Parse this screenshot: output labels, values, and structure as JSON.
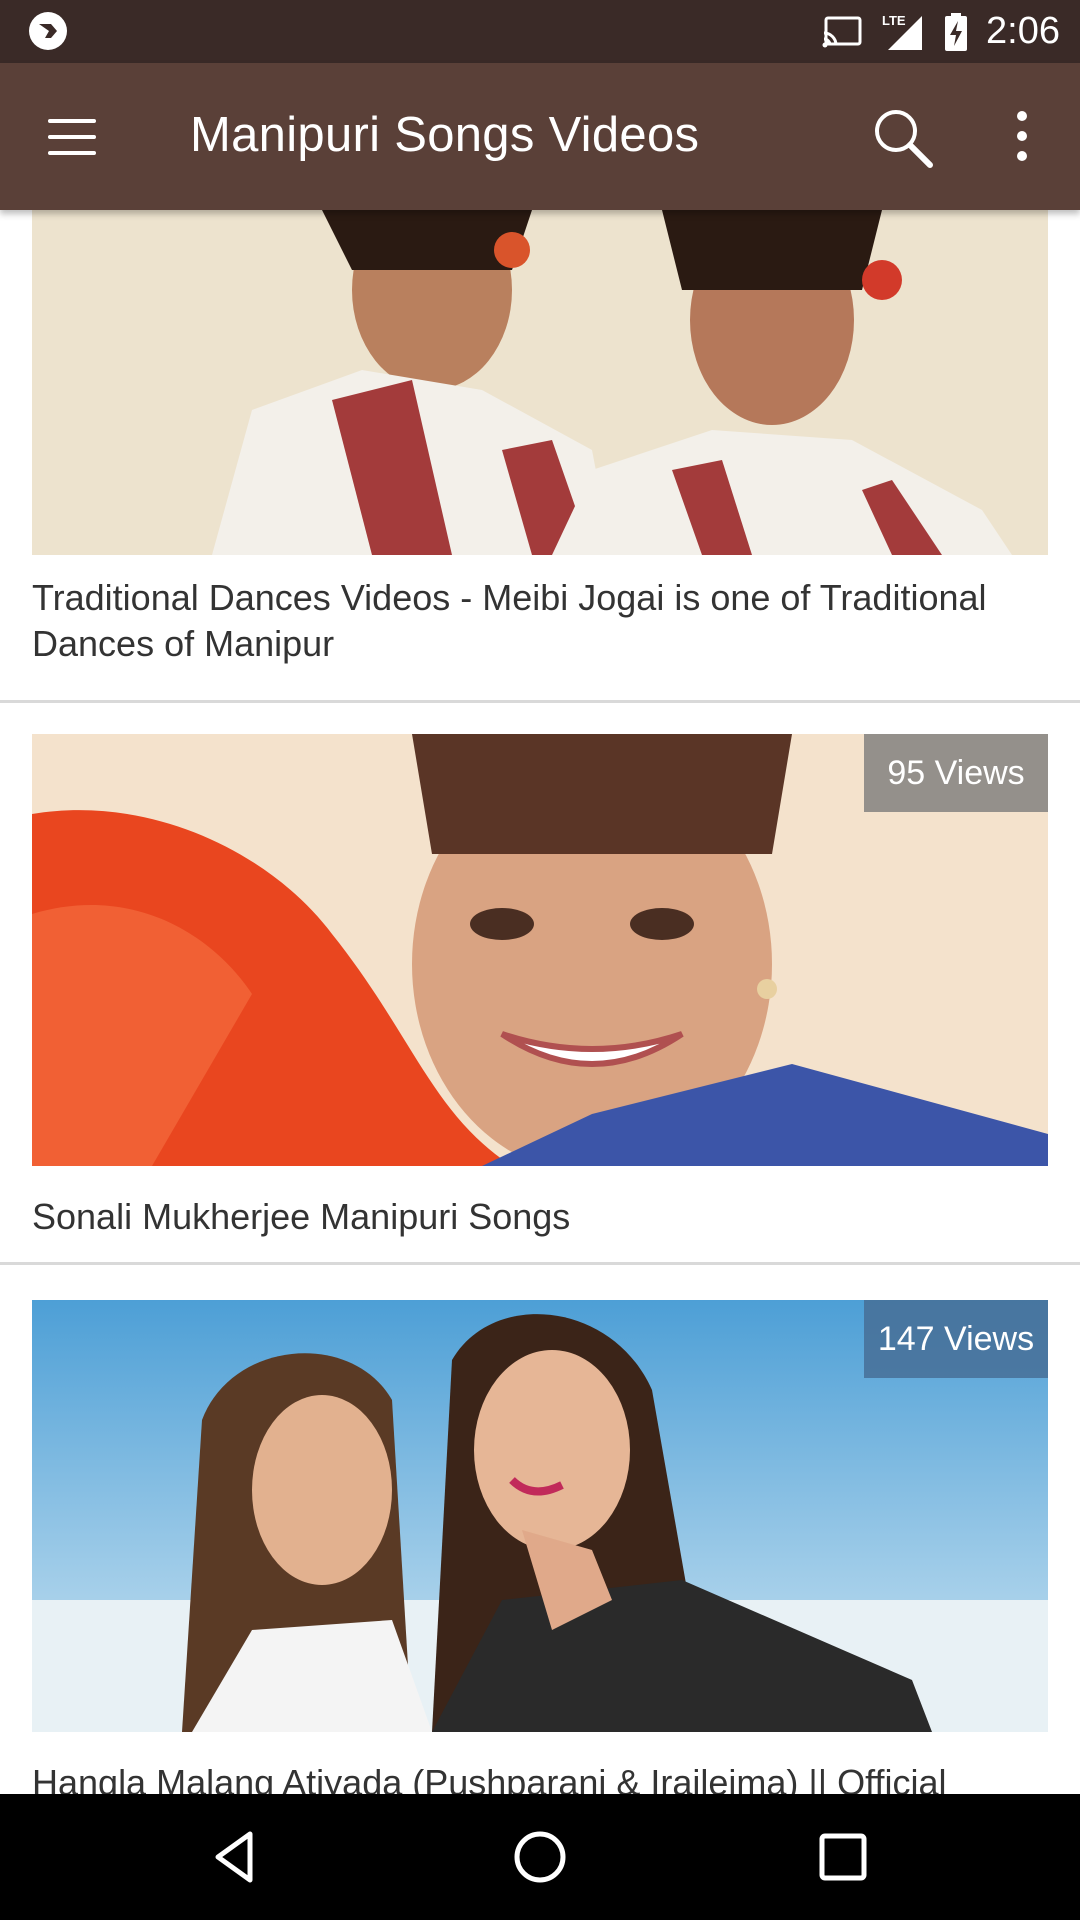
{
  "status_bar": {
    "time": "2:06",
    "network": "LTE",
    "icons": [
      "app-notification-icon",
      "cast-icon",
      "signal-icon",
      "battery-charging-icon"
    ]
  },
  "app_bar": {
    "title": "Manipuri Songs Videos",
    "icons": [
      "menu-icon",
      "search-icon",
      "more-vert-icon"
    ]
  },
  "videos": [
    {
      "title": "Traditional Dances Videos - Meibi Jogai is one of Traditional Dances of Manipur",
      "views": ""
    },
    {
      "title": "Sonali Mukherjee Manipuri Songs",
      "views": "95 Views"
    },
    {
      "title": "Hangla Malang Atiyada (Pushparani & Iraileima) || Official",
      "views": "147 Views"
    }
  ],
  "colors": {
    "status_bar": "#3a2a27",
    "app_bar": "#5a4038",
    "divider": "#d9d9d9",
    "title_text": "#333333",
    "nav_bar": "#000000"
  },
  "nav_bar": {
    "icons": [
      "back-icon",
      "home-icon",
      "recents-icon"
    ]
  }
}
